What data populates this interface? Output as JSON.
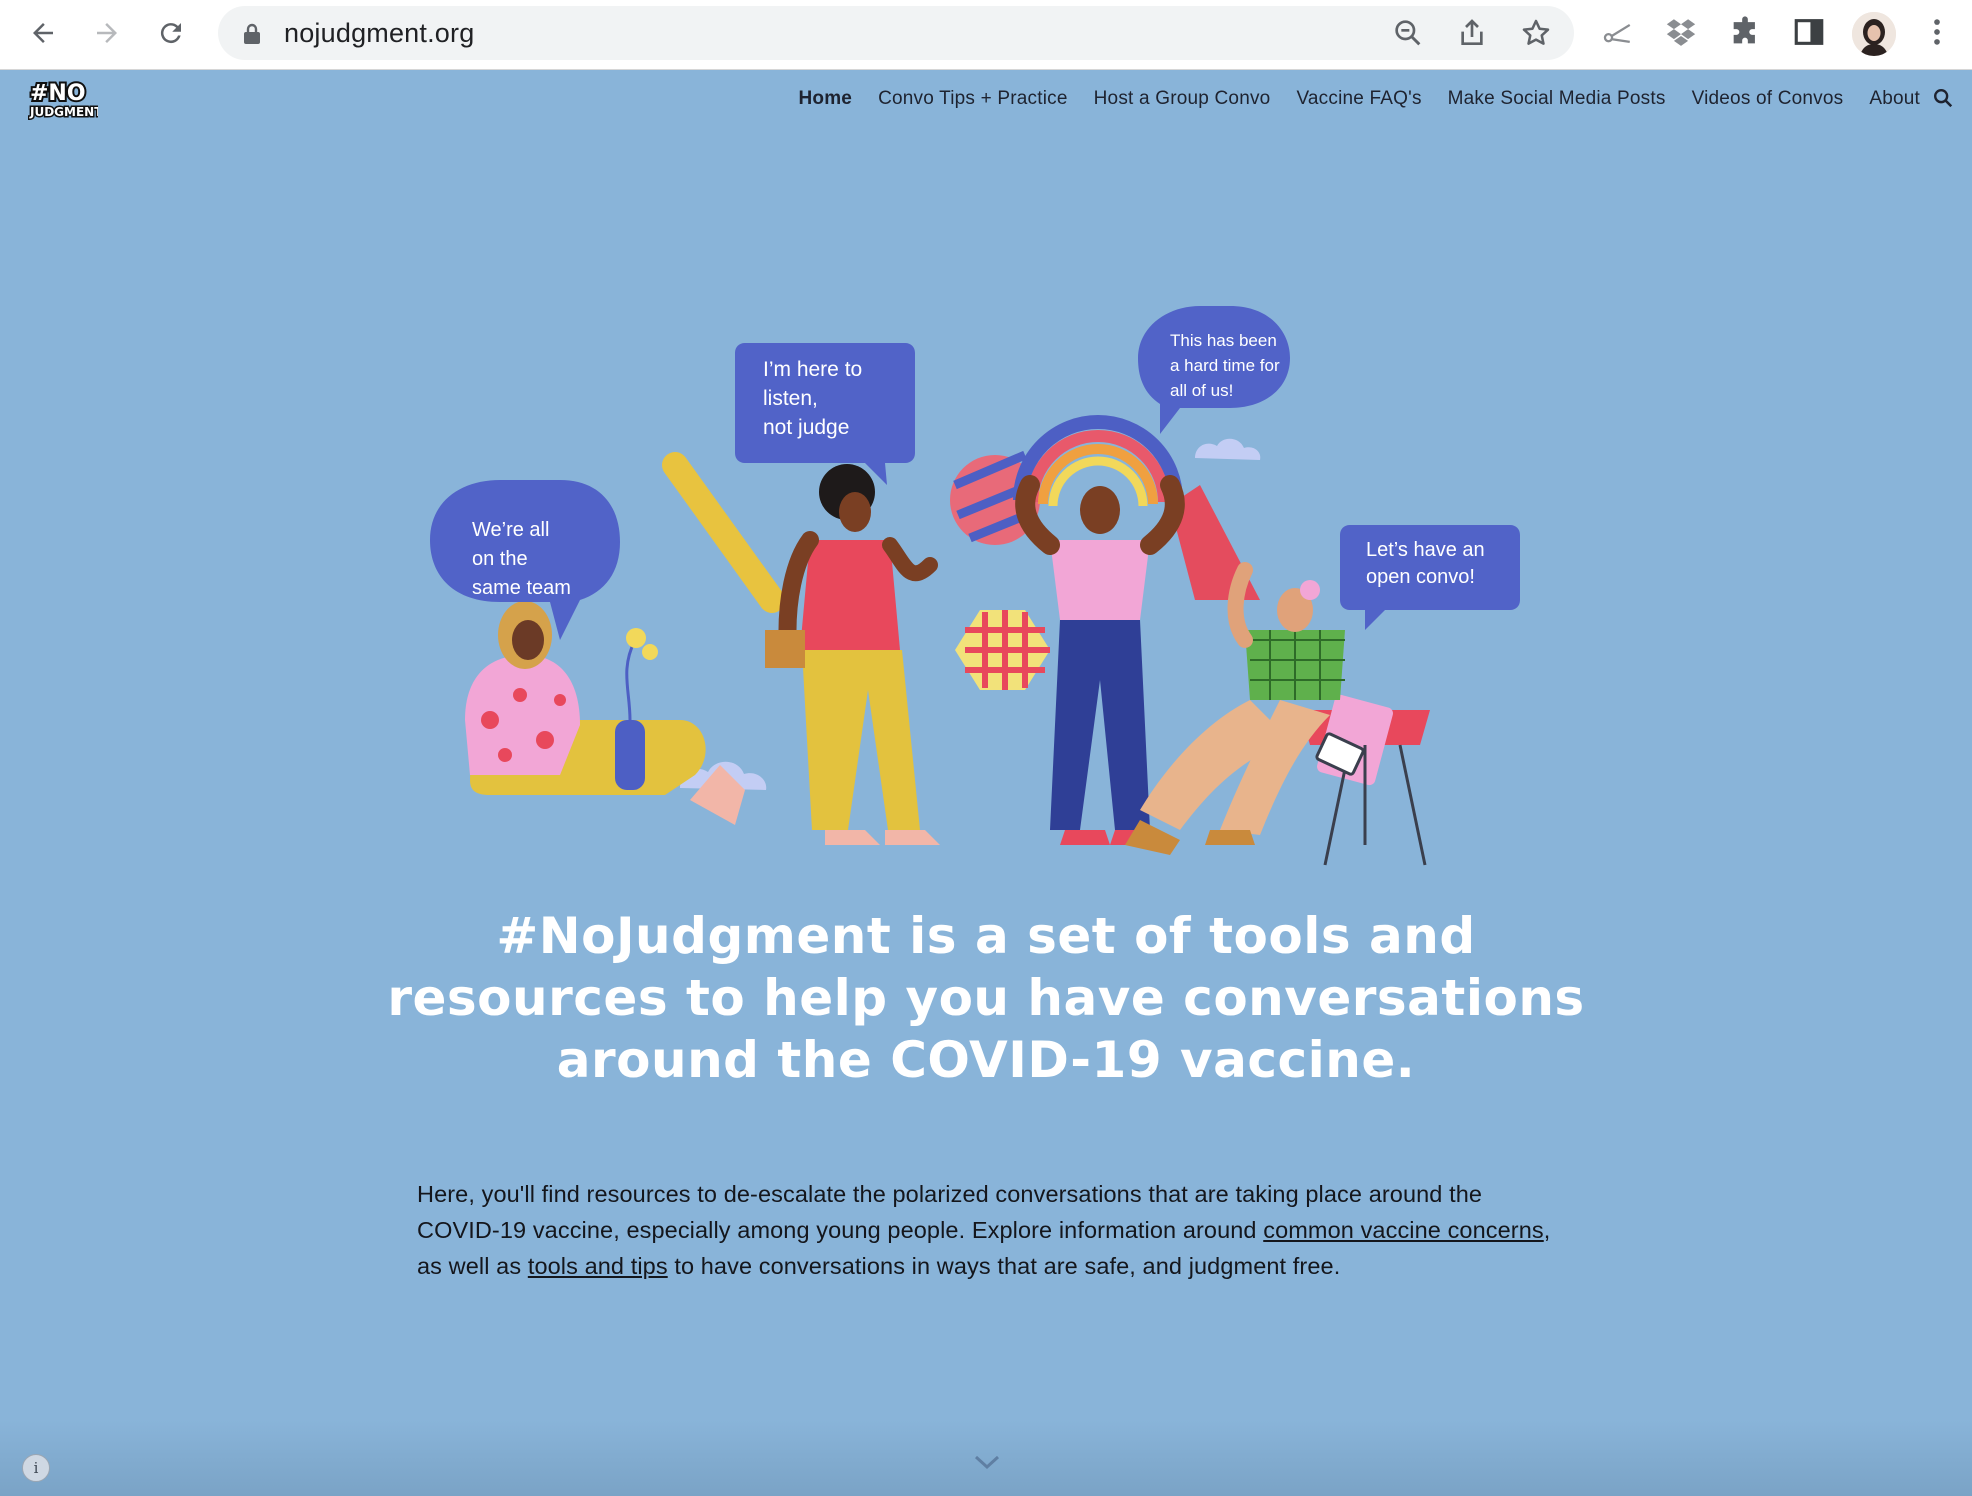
{
  "browser": {
    "url": "nojudgment.org"
  },
  "site": {
    "logo_text": "#NO JUDGMENT",
    "nav": [
      {
        "label": "Home",
        "active": true
      },
      {
        "label": "Convo Tips + Practice"
      },
      {
        "label": "Host a Group Convo"
      },
      {
        "label": "Vaccine FAQ's"
      },
      {
        "label": "Make Social Media Posts"
      },
      {
        "label": "Videos of Convos"
      },
      {
        "label": "About"
      }
    ]
  },
  "hero": {
    "bubbles": {
      "b1": [
        "We’re all",
        "on the",
        "same team"
      ],
      "b2": [
        "I’m here to",
        "listen,",
        "not judge"
      ],
      "b3": [
        "This has been",
        "a hard time for",
        "all of us!"
      ],
      "b4": [
        "Let’s have an",
        "open convo!"
      ]
    }
  },
  "headline": "#NoJudgment is a set of tools and resources to help you have conversations around the COVID-19 vaccine.",
  "intro": {
    "part1": "Here, you'll find resources to de-escalate the polarized conversations that are taking place around the COVID-19 vaccine, especially among young people. Explore information around ",
    "link1": "common vaccine concerns",
    "part2": ", as well as ",
    "link2": "tools and tips",
    "part3": " to have conversations in ways that are safe, and judgment free."
  },
  "colors": {
    "page_bg": "#89b4d9",
    "bubble": "#5163c8",
    "text_dark": "#14161c"
  }
}
